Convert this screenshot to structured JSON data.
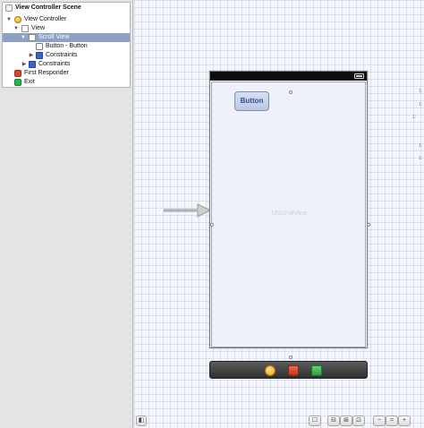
{
  "outline": {
    "scene": "View Controller Scene",
    "view_controller": "View Controller",
    "view": "View",
    "scroll_view": "Scroll View",
    "button": "Button - Button",
    "constraints_inner": "Constraints",
    "constraints_outer": "Constraints",
    "first_responder": "First Responder",
    "exit": "Exit"
  },
  "canvas": {
    "scroll_view_label": "UIScrollView",
    "button_label": "Button"
  },
  "gutter_marks": [
    "1:",
    "1:",
    "1:",
    "1:",
    "1:"
  ],
  "icons": {
    "disclosure_open": "▼",
    "disclosure_closed": "▶",
    "sidebar_toggle": "◧",
    "inferred_metrics": "☐",
    "align": "⊟",
    "pin": "⊞",
    "resolve": "⊡",
    "zoom_out": "−",
    "zoom_fit": "=",
    "zoom_in": "+"
  },
  "colors": {
    "selection": "#8ea1c4",
    "button_text": "#2d4f92"
  }
}
